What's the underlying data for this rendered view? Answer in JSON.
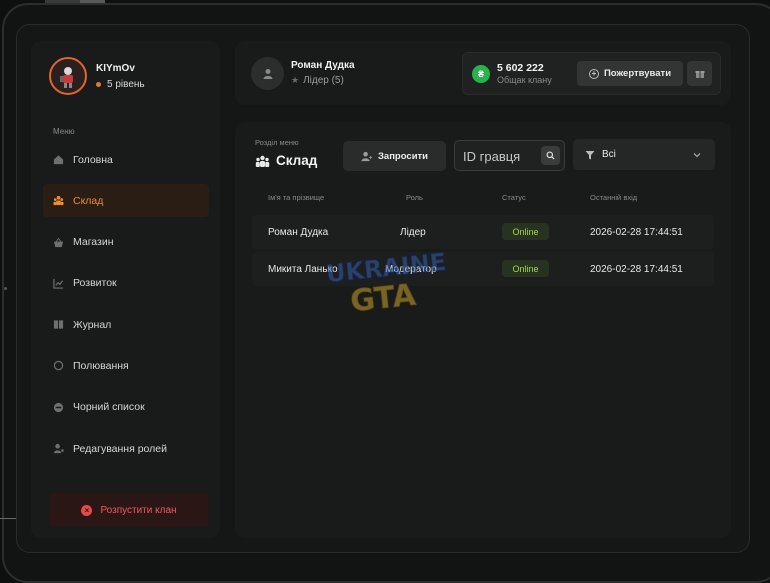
{
  "sidebar": {
    "profile": {
      "name": "KIYmOv",
      "level": "5 рівень"
    },
    "menu_label": "Меню",
    "items": [
      {
        "label": "Головна",
        "icon": "home-icon"
      },
      {
        "label": "Склад",
        "icon": "users-icon",
        "active": true
      },
      {
        "label": "Магазин",
        "icon": "basket-icon"
      },
      {
        "label": "Розвиток",
        "icon": "chart-icon"
      },
      {
        "label": "Журнал",
        "icon": "book-icon"
      },
      {
        "label": "Полювання",
        "icon": "target-icon"
      },
      {
        "label": "Чорний список",
        "icon": "block-icon"
      },
      {
        "label": "Редагування ролей",
        "icon": "user-edit-icon"
      }
    ],
    "disband_label": "Розпустити клан"
  },
  "header": {
    "user_name": "Роман Дудка",
    "user_role": "Лідер (5)",
    "wallet": {
      "amount": "5 602 222",
      "label": "Общак клану",
      "coin_symbol": "₴"
    },
    "donate_label": "Пожертвувати"
  },
  "content": {
    "section_label": "Розділ меню",
    "section_title": "Склад",
    "invite_label": "Запросити",
    "search_placeholder": "ID гравця",
    "filter_value": "Всі",
    "columns": [
      "Ім'я та прізвище",
      "Роль",
      "Статус",
      "Останній вхід"
    ],
    "rows": [
      {
        "name": "Роман Дудка",
        "role": "Лідер",
        "status": "Online",
        "last_login": "2026-02-28 17:44:51"
      },
      {
        "name": "Микита Ланько",
        "role": "Модератор",
        "status": "Online",
        "last_login": "2026-02-28 17:44:51"
      }
    ]
  },
  "watermark": {
    "line1": "UKRAINE",
    "line2": "GTA"
  },
  "colors": {
    "accent": "#f08a3c",
    "online": "#a6d64a",
    "danger": "#ef5a5a",
    "coin": "#27b24a"
  }
}
